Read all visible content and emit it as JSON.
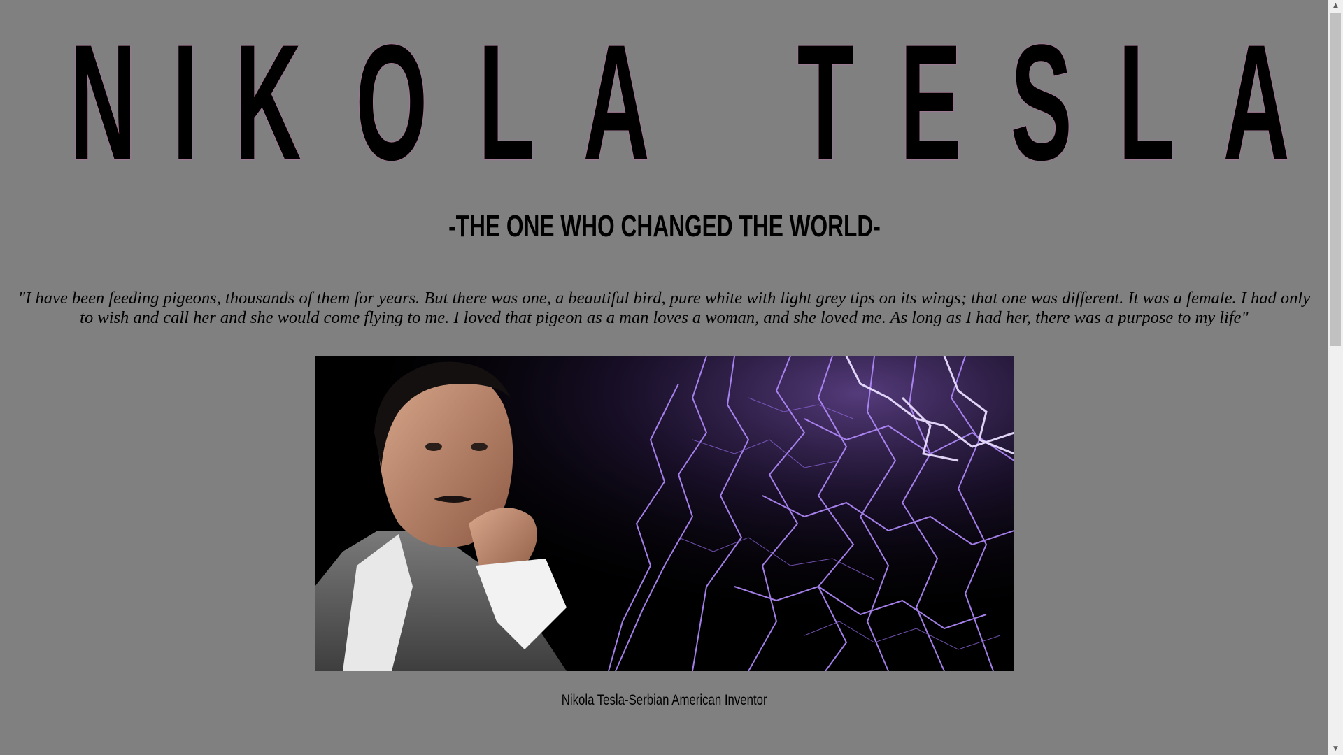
{
  "page": {
    "title_words": [
      [
        "N",
        "I",
        "K",
        "O",
        "L",
        "A"
      ],
      [
        "T",
        "E",
        "S",
        "L",
        "A"
      ]
    ],
    "subtitle": "-THE ONE WHO CHANGED THE WORLD-",
    "quote": "\"I have been feeding pigeons, thousands of them for years. But there was one, a beautiful bird, pure white with light grey tips on its wings; that one was different. It was a female. I had only to wish and call her and she would come flying to me. I loved that pigeon as a man loves a woman, and she loved me. As long as I had her, there was a purpose to my life\"",
    "image_caption": "Nikola Tesla-Serbian American Inventor"
  },
  "scrollbar": {
    "up_arrow": "▲",
    "down_arrow": "▼"
  },
  "colors": {
    "background": "#808080",
    "title_text": "#000000",
    "title_glow": "#a36ccc",
    "lightning": "#b48cff"
  }
}
